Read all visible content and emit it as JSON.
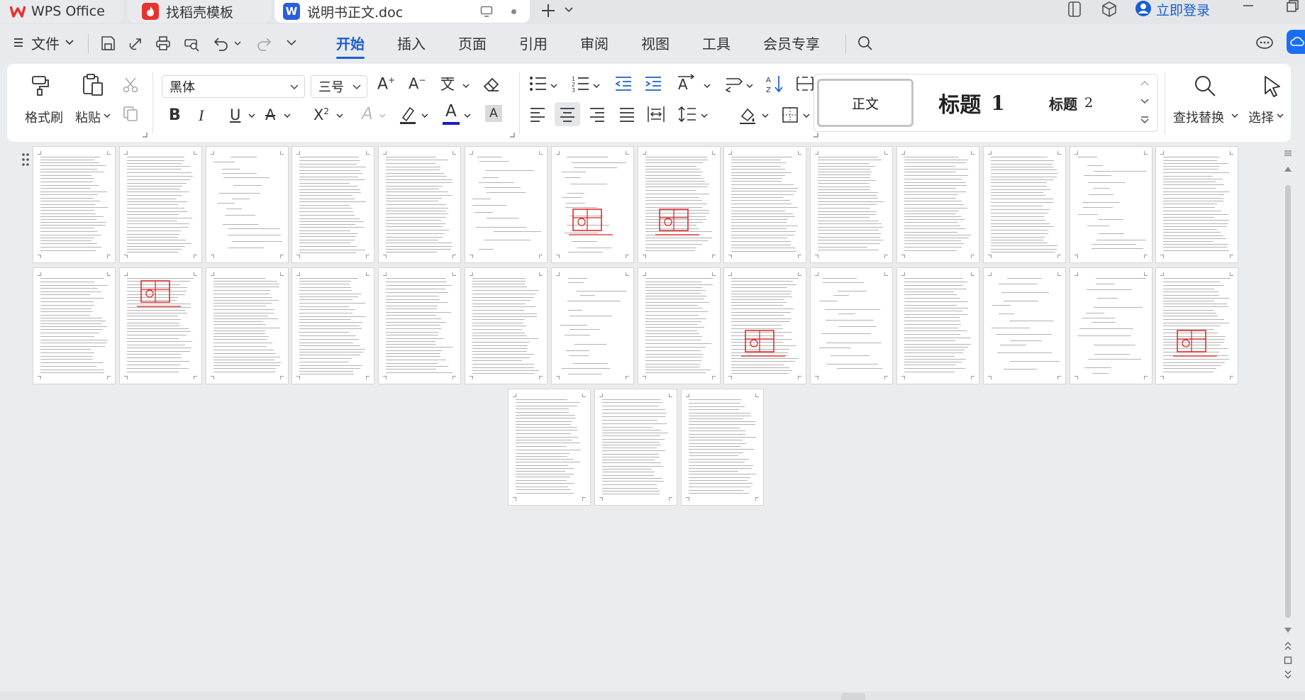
{
  "tabs": {
    "wps_label": "WPS Office",
    "template_label": "找稻壳模板",
    "doc_label": "说明书正文.doc",
    "login_label": "立即登录"
  },
  "menu": {
    "file_label": "文件",
    "items": [
      "开始",
      "插入",
      "页面",
      "引用",
      "审阅",
      "视图",
      "工具",
      "会员专享"
    ],
    "active": "开始"
  },
  "ribbon": {
    "format_painter": "格式刷",
    "paste": "粘贴",
    "font_name": "黑体",
    "font_size": "三号",
    "styles": {
      "normal": "正文",
      "heading1": "标题",
      "heading1_num": "1",
      "heading2": "标题",
      "heading2_num": "2"
    },
    "find_replace": "查找替换",
    "select": "选择"
  },
  "colors": {
    "accent": "#1a5fd0",
    "wps_red": "#e8322d",
    "word_blue": "#2b5fd9",
    "font_color_bar": "#1a1acc",
    "figure_red": "#e02020"
  },
  "pages": {
    "row1_count": 14,
    "row2_count": 14,
    "row3_count": 3
  }
}
